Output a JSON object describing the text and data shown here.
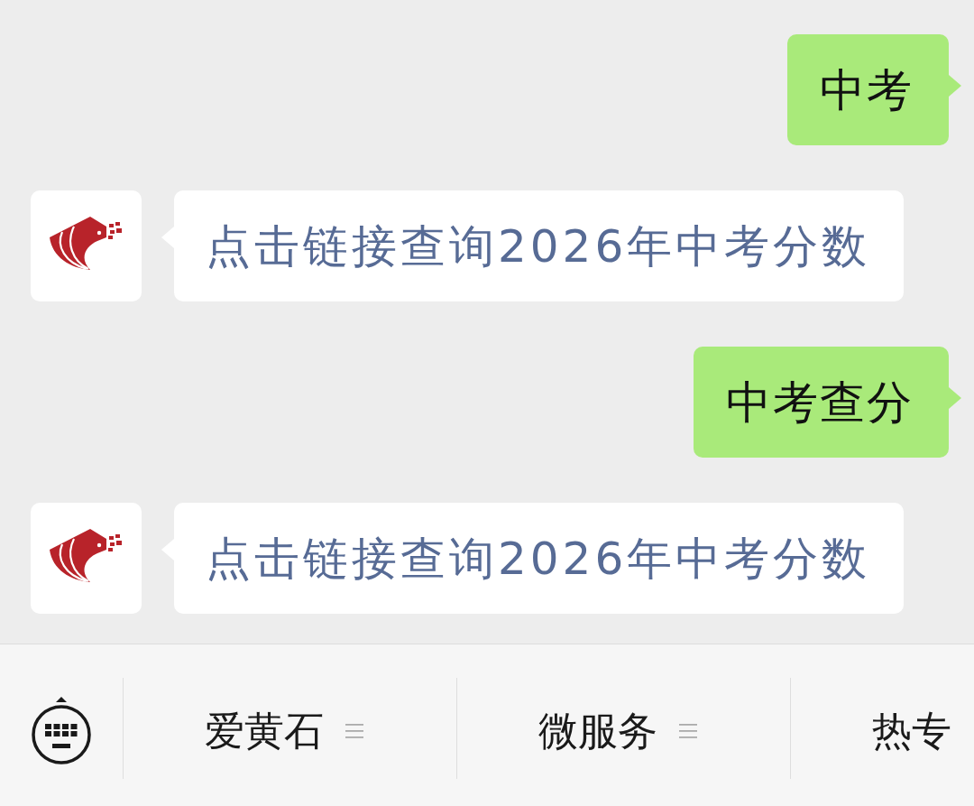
{
  "messages": [
    {
      "kind": "sent",
      "text": "中考",
      "link": false
    },
    {
      "kind": "received",
      "text": "点击链接查询2026年中考分数",
      "link": true
    },
    {
      "kind": "sent",
      "text": "中考查分",
      "link": false
    },
    {
      "kind": "received",
      "text": "点击链接查询2026年中考分数",
      "link": true
    }
  ],
  "menu_bar": {
    "items": [
      {
        "label": "爱黄石",
        "menu_icon": true
      },
      {
        "label": "微服务",
        "menu_icon": true
      },
      {
        "label": "热专",
        "menu_icon": false
      }
    ]
  }
}
